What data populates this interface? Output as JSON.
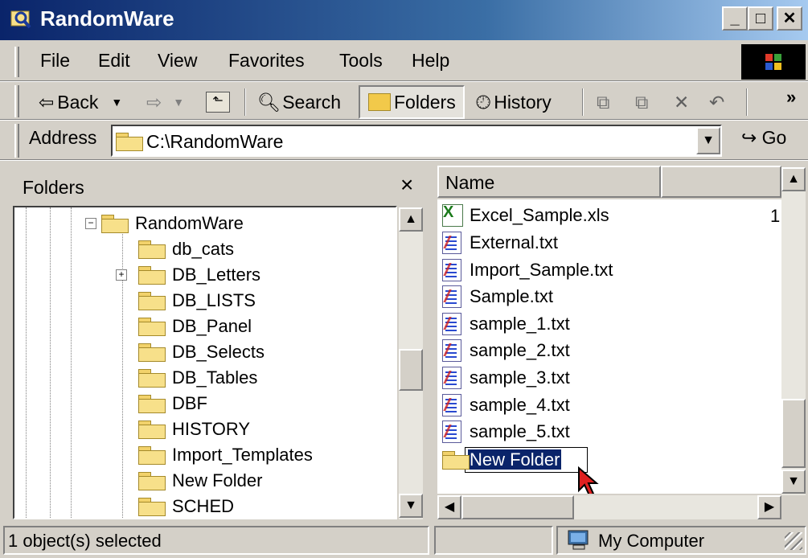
{
  "window": {
    "title": "RandomWare"
  },
  "menu": [
    "File",
    "Edit",
    "View",
    "Favorites",
    "Tools",
    "Help"
  ],
  "toolbar": {
    "back": "Back",
    "search": "Search",
    "folders": "Folders",
    "history": "History",
    "more": "»"
  },
  "address": {
    "label": "Address",
    "value": "C:\\RandomWare",
    "go": "Go"
  },
  "folders_pane": {
    "title": "Folders",
    "close": "×",
    "root": "RandomWare",
    "items": [
      "db_cats",
      "DB_Letters",
      "DB_LISTS",
      "DB_Panel",
      "DB_Selects",
      "DB_Tables",
      "DBF",
      "HISTORY",
      "Import_Templates",
      "New Folder",
      "SCHED"
    ]
  },
  "list_pane": {
    "column_name": "Name",
    "partial_column_value": "1",
    "files": [
      {
        "name": "Excel_Sample.xls",
        "icon": "excel-icon"
      },
      {
        "name": "External.txt",
        "icon": "text-file-icon"
      },
      {
        "name": "Import_Sample.txt",
        "icon": "text-file-icon"
      },
      {
        "name": "Sample.txt",
        "icon": "text-file-icon"
      },
      {
        "name": "sample_1.txt",
        "icon": "text-file-icon"
      },
      {
        "name": "sample_2.txt",
        "icon": "text-file-icon"
      },
      {
        "name": "sample_3.txt",
        "icon": "text-file-icon"
      },
      {
        "name": "sample_4.txt",
        "icon": "text-file-icon"
      },
      {
        "name": "sample_5.txt",
        "icon": "text-file-icon"
      }
    ],
    "editing_folder": "New Folder"
  },
  "status": {
    "selection": "1 object(s) selected",
    "location": "My Computer"
  },
  "colors": {
    "title_start": "#0a246a",
    "title_end": "#a6caf0",
    "selection": "#0a246a"
  }
}
